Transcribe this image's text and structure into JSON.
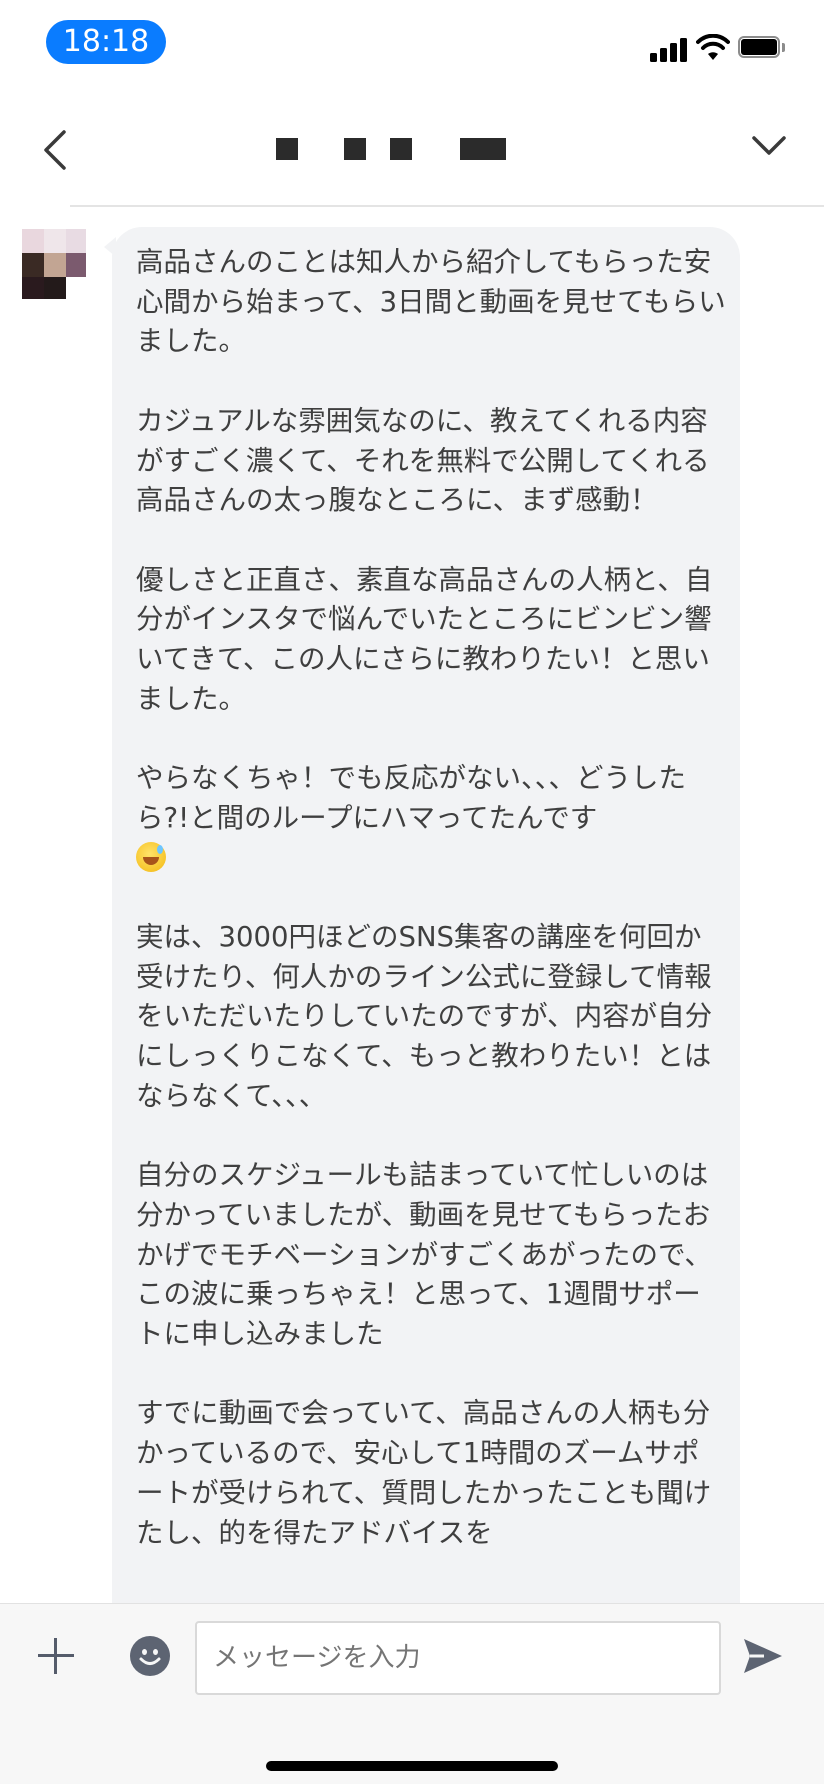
{
  "status_bar": {
    "time": "18:18",
    "icons": [
      "cellular-signal-icon",
      "wifi-icon",
      "battery-icon"
    ]
  },
  "header": {
    "back_icon": "chevron-left-icon",
    "menu_icon": "chevron-down-icon",
    "title_redacted": true
  },
  "message": {
    "sender_avatar": "blurred-avatar",
    "paragraphs": [
      "高品さんのことは知人から紹介してもらった安心間から始まって、3日間と動画を見せてもらいました。",
      "カジュアルな雰囲気なのに、教えてくれる内容がすごく濃くて、それを無料で公開してくれる高品さんの太っ腹なところに、まず感動！",
      "優しさと正直さ、素直な高品さんの人柄と、自分がインスタで悩んでいたところにビンビン響いてきて、この人にさらに教わりたい！と思いました。",
      "やらなくちゃ！でも反応がない、、、どうしたら?!と間のループにハマってたんです",
      "実は、3000円ほどのSNS集客の講座を何回か受けたり、何人かのライン公式に登録して情報をいただいたりしていたのですが、内容が自分にしっくりこなくて、もっと教わりたい！とはならなくて、、、",
      "自分のスケジュールも詰まっていて忙しいのは分かっていましたが、動画を見せてもらったおかげでモチベーションがすごくあがったので、この波に乗っちゃえ！と思って、1週間サポートに申し込みました",
      "すでに動画で会っていて、高品さんの人柄も分かっているので、安心して1時間のズームサポートが受けられて、質問したかったことも聞けたし、的を得たアドバイスを"
    ],
    "emoji": "grinning-sweat-emoji"
  },
  "input_bar": {
    "placeholder": "メッセージを入力",
    "plus_icon": "plus-icon",
    "emoji_icon": "smiley-icon",
    "send_icon": "send-icon"
  }
}
